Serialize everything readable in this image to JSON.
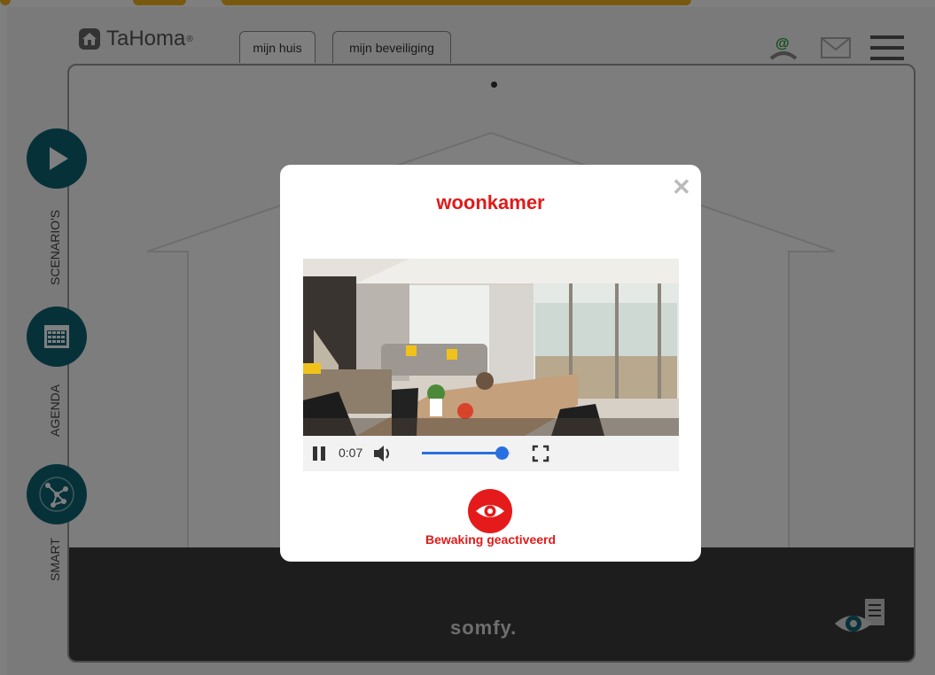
{
  "app": {
    "logo_text": "TaHoma",
    "logo_mark": "®",
    "brand_footer": "somfy."
  },
  "tabs": [
    {
      "label": "mijn huis",
      "active": true
    },
    {
      "label": "mijn beveiliging",
      "active": false
    }
  ],
  "header_icons": [
    "user-at-icon",
    "mail-icon",
    "menu-icon"
  ],
  "sidebar": {
    "items": [
      {
        "label": "SCENARIO'S",
        "icon": "play-icon"
      },
      {
        "label": "AGENDA",
        "icon": "calendar-icon"
      },
      {
        "label": "SMART",
        "icon": "network-icon"
      }
    ]
  },
  "modal": {
    "title": "woonkamer",
    "video": {
      "time": "0:07",
      "volume_level": 0.9
    },
    "status_label": "Bewaking geactiveerd"
  },
  "colors": {
    "accent_red": "#e01a1a",
    "teal": "#0f6272",
    "slider_blue": "#2a6fe0",
    "top_yellow": "#f2b31c"
  }
}
